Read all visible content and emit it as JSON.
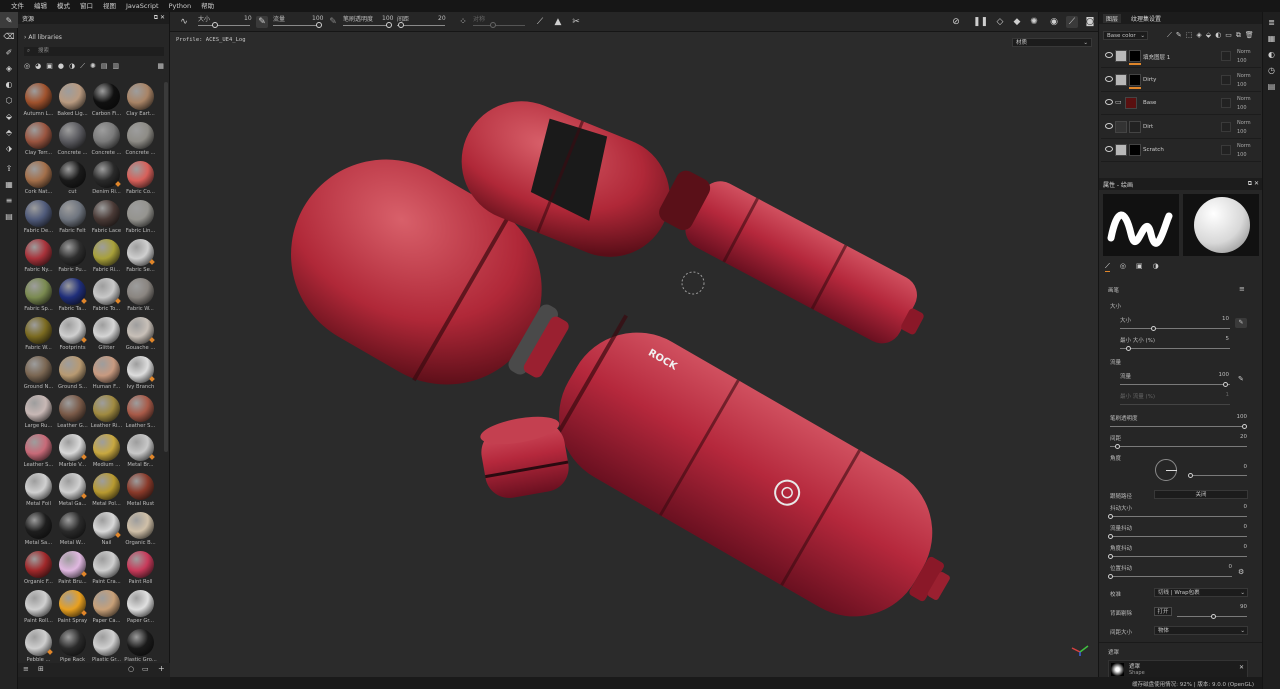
{
  "menu": [
    "文件",
    "编辑",
    "模式",
    "窗口",
    "视图",
    "JavaScript",
    "Python",
    "帮助"
  ],
  "toolbar": {
    "size_label": "大小",
    "size_value": "10",
    "flow_label": "流量",
    "flow_value": "100",
    "stroke_opacity_label": "笔刷透明度",
    "stroke_opacity_value": "100",
    "spacing_label": "间距",
    "spacing_value": "20",
    "symmetry_label": "对称"
  },
  "assets": {
    "title": "资源",
    "library": "All libraries",
    "search_placeholder": "搜索",
    "materials": [
      {
        "name": "Autumn L...",
        "color": "#a0522d",
        "tex": "leaf",
        "dot": false
      },
      {
        "name": "Baked Lig...",
        "color": "#b89a80",
        "dot": false
      },
      {
        "name": "Carbon Fi...",
        "color": "#101010",
        "dot": false
      },
      {
        "name": "Clay Eart...",
        "color": "#a98466",
        "dot": false
      },
      {
        "name": "Clay Terr...",
        "color": "#9a5540",
        "dot": false
      },
      {
        "name": "Concrete ...",
        "color": "#5a5a5f",
        "dot": false
      },
      {
        "name": "Concrete ...",
        "color": "#7a7a7a",
        "dot": false
      },
      {
        "name": "Concrete ...",
        "color": "#8e8c86",
        "dot": false
      },
      {
        "name": "Cork Nat...",
        "color": "#a36f4a",
        "dot": false
      },
      {
        "name": "cut",
        "color": "#1a1a1a",
        "tex": "cut",
        "dot": false
      },
      {
        "name": "Denim Ri...",
        "color": "#2a2a2a",
        "tex": "ring",
        "dot": true
      },
      {
        "name": "Fabric Co...",
        "color": "#d8605a",
        "dot": false
      },
      {
        "name": "Fabric De...",
        "color": "#4f5a7a",
        "dot": false
      },
      {
        "name": "Fabric Felt",
        "color": "#6f757f",
        "dot": false
      },
      {
        "name": "Fabric Lace",
        "color": "#4a3a36",
        "dot": false
      },
      {
        "name": "Fabric Lin...",
        "color": "#95948f",
        "dot": false
      },
      {
        "name": "Fabric Ny...",
        "color": "#a8323a",
        "dot": false
      },
      {
        "name": "Fabric Pu...",
        "color": "#2e2e2e",
        "tex": "stick",
        "dot": false
      },
      {
        "name": "Fabric Ri...",
        "color": "#a8a03a",
        "dot": false
      },
      {
        "name": "Fabric Se...",
        "color": "#cfcfcf",
        "tex": "split",
        "dot": true
      },
      {
        "name": "Fabric Sp...",
        "color": "#7a8a50",
        "dot": false
      },
      {
        "name": "Fabric Ta...",
        "color": "#1f2e7a",
        "dot": true
      },
      {
        "name": "Fabric To...",
        "color": "#c8c8c8",
        "tex": "split",
        "dot": true
      },
      {
        "name": "Fabric W...",
        "color": "#8a8580",
        "dot": false
      },
      {
        "name": "Fabric W...",
        "color": "#7a6a20",
        "dot": false
      },
      {
        "name": "Footprints",
        "color": "#cfcfcf",
        "dot": true
      },
      {
        "name": "Glitter",
        "color": "#d5d5d5",
        "tex": "dotc",
        "dot": false
      },
      {
        "name": "Gouache ...",
        "color": "#c8c0b8",
        "dot": true
      },
      {
        "name": "Ground N...",
        "color": "#7a6652",
        "dot": false
      },
      {
        "name": "Ground S...",
        "color": "#b89a72",
        "dot": false
      },
      {
        "name": "Human F...",
        "color": "#c89a80",
        "dot": false
      },
      {
        "name": "Ivy Branch",
        "color": "#dddddd",
        "tex": "leafw",
        "dot": true
      },
      {
        "name": "Large Ru...",
        "color": "#c8b8b5",
        "tex": "stripe",
        "dot": false
      },
      {
        "name": "Leather G...",
        "color": "#7a5a48",
        "dot": false
      },
      {
        "name": "Leather Ri...",
        "color": "#a08a40",
        "dot": false
      },
      {
        "name": "Leather S...",
        "color": "#a85a48",
        "dot": false
      },
      {
        "name": "Leather S...",
        "color": "#c86a78",
        "dot": false
      },
      {
        "name": "Marble V...",
        "color": "#d8d8d8",
        "dot": true
      },
      {
        "name": "Medium ...",
        "color": "#c8a840",
        "dot": false
      },
      {
        "name": "Metal Br...",
        "color": "#c8c8c8",
        "tex": "dark",
        "dot": true
      },
      {
        "name": "Metal Foil",
        "color": "#d0d0d0",
        "dot": false
      },
      {
        "name": "Metal Ga...",
        "color": "#d0d0d0",
        "dot": true
      },
      {
        "name": "Metal Pol...",
        "color": "#b89a30",
        "dot": false
      },
      {
        "name": "Metal Rust",
        "color": "#8a3a2a",
        "dot": false
      },
      {
        "name": "Metal Sa...",
        "color": "#1e1e1e",
        "dot": false
      },
      {
        "name": "Metal W...",
        "color": "#2a2a2a",
        "tex": "gear",
        "dot": false
      },
      {
        "name": "Nail",
        "color": "#d8d8d8",
        "tex": "nail",
        "dot": true
      },
      {
        "name": "Organic B...",
        "color": "#d0c0a8",
        "dot": false
      },
      {
        "name": "Organic F...",
        "color": "#a0282a",
        "dot": false
      },
      {
        "name": "Paint Bru...",
        "color": "#e0b8e0",
        "dot": true
      },
      {
        "name": "Paint Cra...",
        "color": "#cfcfcf",
        "dot": false
      },
      {
        "name": "Paint Roll",
        "color": "#c83a5a",
        "dot": false
      },
      {
        "name": "Paint Roll...",
        "color": "#d0d0d0",
        "dot": false
      },
      {
        "name": "Paint Spray",
        "color": "#e8a020",
        "dot": true
      },
      {
        "name": "Paper Ca...",
        "color": "#c8a078",
        "dot": false
      },
      {
        "name": "Paper Gr...",
        "color": "#e0e0e0",
        "dot": false
      },
      {
        "name": "Pebble ...",
        "color": "#cfcfcf",
        "dot": true
      },
      {
        "name": "Pipe Rack",
        "color": "#2a2a2a",
        "tex": "pipe",
        "dot": false
      },
      {
        "name": "Plastic Gr...",
        "color": "#d0d0d0",
        "dot": false
      },
      {
        "name": "Plastic Gro...",
        "color": "#1a1a1a",
        "dot": false
      }
    ]
  },
  "viewport": {
    "profile": "Profile: ACES_UE4_Log",
    "channel": "材质"
  },
  "layers": {
    "tab1": "图层",
    "tab2": "纹理集设置",
    "blend_select": "Base color",
    "items": [
      {
        "name": "填充图层 1",
        "blend": "Norm",
        "opacity": "100",
        "swatch1": "#b8b8b8",
        "swatch2": "#000000",
        "bar": true
      },
      {
        "name": "Dirty",
        "blend": "Norm",
        "opacity": "100",
        "swatch1": "#b8b8b8",
        "swatch2": "#000000",
        "bar": true
      },
      {
        "name": "Base",
        "blend": "Norm",
        "opacity": "100",
        "swatch1": "#5a1010",
        "swatch2": "",
        "bar": false,
        "folder": true
      },
      {
        "name": "Dirt",
        "blend": "Norm",
        "opacity": "100",
        "swatch1": "#333333",
        "swatch2": "#222222",
        "bar": false
      },
      {
        "name": "Scratch",
        "blend": "Norm",
        "opacity": "100",
        "swatch1": "#b8b8b8",
        "swatch2": "#000000",
        "bar": false
      }
    ]
  },
  "properties": {
    "title": "属性 - 绘画",
    "section": "画笔",
    "size_group": "大小",
    "size_label": "大小",
    "size_value": "10",
    "min_size_label": "最小 大小 (%)",
    "min_size_value": "5",
    "flow_group": "流量",
    "flow_label": "流量",
    "flow_value": "100",
    "min_flow_label": "最小 流量 (%)",
    "min_flow_value": "1",
    "stroke_opacity_label": "笔刷透明度",
    "stroke_opacity_value": "100",
    "spacing_label": "间距",
    "spacing_value": "20",
    "angle_label": "角度",
    "angle_value": "0",
    "follow_path_label": "跟随路径",
    "follow_path_value": "关闭",
    "size_jitter_label": "抖动大小",
    "size_jitter_value": "0",
    "flow_jitter_label": "流量抖动",
    "flow_jitter_value": "0",
    "angle_jitter_label": "角度抖动",
    "angle_jitter_value": "0",
    "pos_jitter_label": "位置抖动",
    "pos_jitter_value": "0",
    "alignment_label": "校准",
    "alignment_value": "切线 | Wrap包裹",
    "backface_label": "背面剔除",
    "backface_toggle": "打开",
    "backface_value": "90",
    "spacing_size_label": "间距大小",
    "spacing_size_value": "物体",
    "alpha_section": "遮罩",
    "alpha_name": "遮罩",
    "alpha_sub": "Shape"
  },
  "status": {
    "text": "缓存磁盘使用情况:  92%  |  版本: 9.0.0 (OpenGL)"
  },
  "colors": {
    "accent": "#e0862a",
    "body_red": "#b5283c"
  }
}
